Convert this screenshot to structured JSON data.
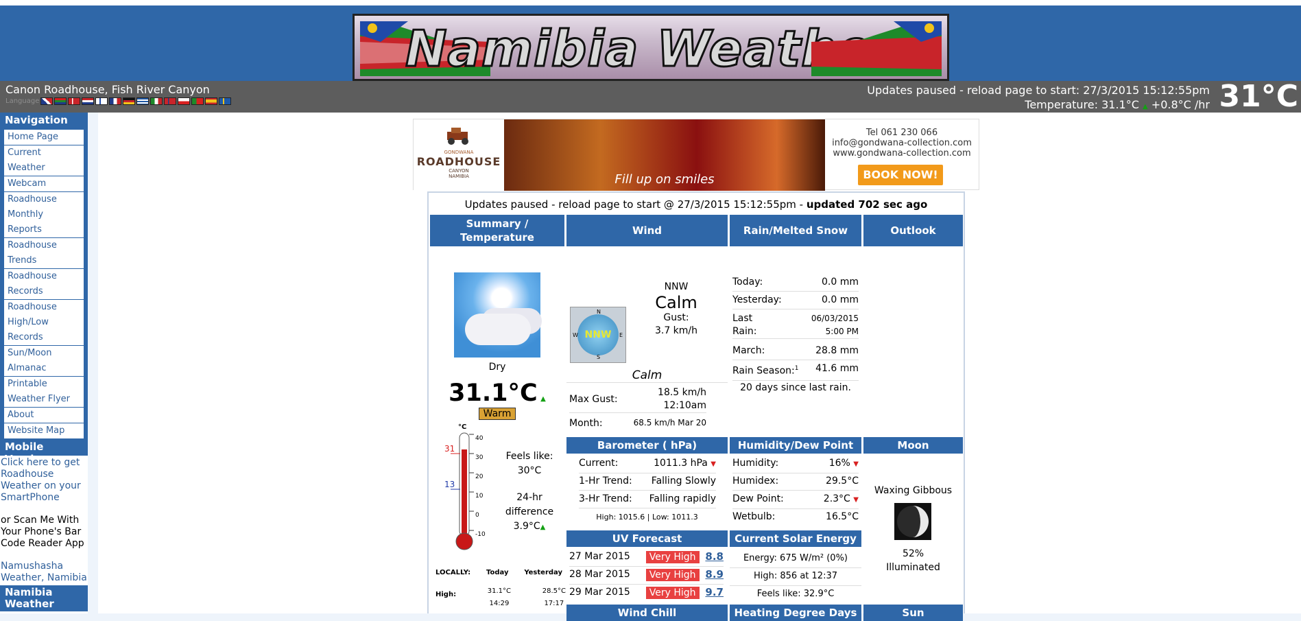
{
  "header": {
    "site_title": "Namibia Weather",
    "location": "Canon Roadhouse, Fish River Canyon",
    "language_label": "Language",
    "updates_line": "Updates paused - reload page to start:  27/3/2015  15:12:55pm",
    "temp_line": "Temperature: 31.1°C",
    "temp_rate": "+0.8°C /hr",
    "big_temp": "31°C"
  },
  "colors": {
    "brand": "#2f67a8",
    "infobar": "#5d5d5d",
    "warm": "#d9a234",
    "very_high": "#e84040"
  },
  "languages": [
    "en",
    "za",
    "dk",
    "nl",
    "fi",
    "fr",
    "de",
    "gr",
    "it",
    "no",
    "pl",
    "pt",
    "es",
    "se"
  ],
  "sidebar": {
    "nav_title": "Navigation",
    "items": [
      {
        "label": "Home Page"
      },
      {
        "label": "Current Weather"
      },
      {
        "label": "Webcam"
      },
      {
        "label": "Roadhouse Monthly Reports"
      },
      {
        "label": "Roadhouse Trends"
      },
      {
        "label": "Roadhouse Records"
      },
      {
        "label": "Roadhouse High/Low Records"
      },
      {
        "label": "Sun/Moon Almanac"
      },
      {
        "label": "Printable Weather Flyer"
      },
      {
        "label": "About"
      },
      {
        "label": "Website Map"
      }
    ],
    "mobile_title": "Mobile Version",
    "mobile_link": "Click here to get Roadhouse Weather on your SmartPhone",
    "scan_text": "or Scan Me With Your Phone's Bar Code Reader App",
    "namushasha_link": "Namushasha Weather, Namibia",
    "namibia_title": "Namibia Weather"
  },
  "ad": {
    "logo_brand": "GONDWANA",
    "logo_name": "ROADHOUSE",
    "logo_sub": "CANYON",
    "logo_country": "NAMIBIA",
    "slogan": "Fill up on smiles",
    "phone": "Tel 061 230 066",
    "email": "info@gondwana-collection.com",
    "web": "www.gondwana-collection.com",
    "book": "BOOK NOW!"
  },
  "main": {
    "status_prefix": "Updates paused - reload page to start @ 27/3/2015 15:12:55pm - ",
    "status_bold": "updated 702 sec ago",
    "headers": {
      "summary": "Summary / Temperature",
      "wind": "Wind",
      "rain": "Rain/Melted Snow",
      "outlook": "Outlook"
    },
    "summary": {
      "condition": "Dry",
      "temp": "31.1°C",
      "temp_trend": "▲",
      "warm_label": "Warm",
      "feels_label": "Feels like:",
      "feels_value": "30°C",
      "diff_label": "24-hr difference",
      "diff_value": "3.9°C",
      "therm_unit": "°C",
      "therm_high": "31",
      "therm_low": "13",
      "therm_ticks": [
        "40",
        "30",
        "20",
        "10",
        "0",
        "-10"
      ],
      "locally": "LOCALLY:",
      "today": "Today",
      "yesterday": "Yesterday",
      "high_label": "High:",
      "high_today": "31.1°C",
      "high_today_time": "14:29",
      "high_yest": "28.5°C",
      "high_yest_time": "17:17"
    },
    "wind": {
      "dir": "NNW",
      "speed": "Calm",
      "gust_label": "Gust:",
      "gust": "3.7 km/h",
      "compass_label": "NNW",
      "compass_n": "N",
      "compass_s": "S",
      "compass_e": "E",
      "compass_w": "W",
      "calm_italic": "Calm",
      "max_gust_label": "Max Gust:",
      "max_gust": "18.5 km/h",
      "max_gust_time": "12:10am",
      "month_label": "Month:",
      "month_value": "68.5 km/h Mar 20"
    },
    "rain": {
      "rows": [
        {
          "label": "Today:",
          "value": "0.0 mm"
        },
        {
          "label": "Yesterday:",
          "value": "0.0 mm"
        }
      ],
      "last_label": "Last Rain:",
      "last_date": "06/03/2015",
      "last_time": "5:00 PM",
      "march_label": "March:",
      "march_value": "28.8 mm",
      "season_label": "Rain Season:",
      "season_sup": "1",
      "season_value": "41.6 mm",
      "since": "20 days since last rain."
    },
    "baro": {
      "title": "Barometer ( hPa)",
      "current_label": "Current:",
      "current": "1011.3 hPa",
      "trend1_label": "1-Hr Trend:",
      "trend1": "Falling Slowly",
      "trend3_label": "3-Hr Trend:",
      "trend3": "Falling rapidly",
      "hilo": "High: 1015.6 | Low:  1011.3"
    },
    "humidity": {
      "title": "Humidity/Dew Point",
      "hum_label": "Humidity:",
      "hum": "16%",
      "humidex_label": "Humidex:",
      "humidex": "29.5°C",
      "dew_label": "Dew Point:",
      "dew": "2.3°C",
      "wetbulb_label": "Wetbulb:",
      "wetbulb": "16.5°C"
    },
    "moon": {
      "title": "Moon",
      "phase": "Waxing Gibbous",
      "illum": "52%",
      "illum_label": "Illuminated"
    },
    "uv": {
      "title": "UV Forecast",
      "rows": [
        {
          "date": "27 Mar 2015",
          "level": "Very High",
          "value": "8.8"
        },
        {
          "date": "28 Mar 2015",
          "level": "Very High",
          "value": "8.9"
        },
        {
          "date": "29 Mar 2015",
          "level": "Very High",
          "value": "9.7"
        }
      ]
    },
    "solar": {
      "title": "Current Solar Energy",
      "energy": "Energy: 675 W/m² (0%)",
      "high": "High: 856 at  12:37",
      "feels": "Feels like: 32.9°C"
    },
    "bottom": {
      "wind_chill": "Wind Chill",
      "heating": "Heating Degree Days",
      "sun": "Sun"
    }
  }
}
